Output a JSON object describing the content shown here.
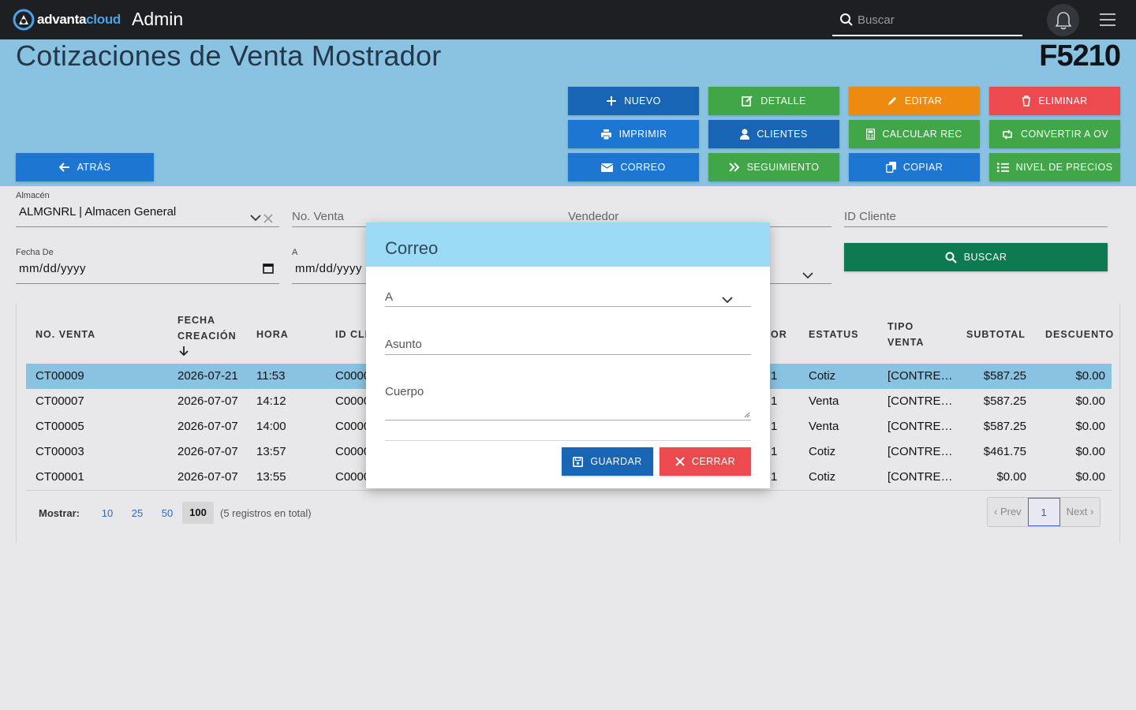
{
  "topbar": {
    "logo_part1": "advanta",
    "logo_part2": "cloud",
    "app_title": "Admin",
    "search_placeholder": "Buscar"
  },
  "header": {
    "title": "Cotizaciones de Venta Mostrador",
    "code": "F5210"
  },
  "actions": {
    "nuevo": "NUEVO",
    "detalle": "DETALLE",
    "editar": "EDITAR",
    "eliminar": "ELIMINAR",
    "imprimir": "IMPRIMIR",
    "clientes": "CLIENTES",
    "calcular_rec": "CALCULAR REC",
    "convertir_ov": "CONVERTIR A OV",
    "atras": "ATRÁS",
    "correo": "CORREO",
    "seguimiento": "SEGUIMIENTO",
    "copiar": "COPIAR",
    "nivel_precios": "NIVEL DE PRECIOS",
    "buscar": "BUSCAR"
  },
  "filters": {
    "almacen_label": "Almacén",
    "almacen_value": "ALMGNRL | Almacen General",
    "no_venta_placeholder": "No. Venta",
    "vendedor_placeholder": "Vendedor",
    "id_cliente_placeholder": "ID Cliente",
    "fecha_de_label": "Fecha De",
    "fecha_de_value": "mm/dd/yyyy",
    "fecha_a_label": "A",
    "fecha_a_value": "mm/dd/yyyy"
  },
  "table": {
    "headers": {
      "no_venta": "NO. VENTA",
      "fecha_l1": "FECHA",
      "fecha_l2": "CREACIÓN",
      "hora": "HORA",
      "id_cliente": "ID CLI",
      "vendedor_tail": "OR",
      "estatus": "ESTATUS",
      "tipo_l1": "TIPO",
      "tipo_l2": "VENTA",
      "subtotal": "SUBTOTAL",
      "descuento": "DESCUENTO"
    },
    "rows": [
      {
        "no": "CT00009",
        "fecha": "2026-07-21",
        "hora": "11:53",
        "cliente": "C0000",
        "vend": "1",
        "estatus": "Cotiz",
        "tipo": "[CONTRE…",
        "subtotal": "$587.25",
        "descuento": "$0.00"
      },
      {
        "no": "CT00007",
        "fecha": "2026-07-07",
        "hora": "14:12",
        "cliente": "C0000",
        "vend": "1",
        "estatus": "Venta",
        "tipo": "[CONTRE…",
        "subtotal": "$587.25",
        "descuento": "$0.00"
      },
      {
        "no": "CT00005",
        "fecha": "2026-07-07",
        "hora": "14:00",
        "cliente": "C0000",
        "vend": "1",
        "estatus": "Venta",
        "tipo": "[CONTRE…",
        "subtotal": "$587.25",
        "descuento": "$0.00"
      },
      {
        "no": "CT00003",
        "fecha": "2026-07-07",
        "hora": "13:57",
        "cliente": "C0000",
        "vend": "1",
        "estatus": "Cotiz",
        "tipo": "[CONTRE…",
        "subtotal": "$461.75",
        "descuento": "$0.00"
      },
      {
        "no": "CT00001",
        "fecha": "2026-07-07",
        "hora": "13:55",
        "cliente": "C0000",
        "vend": "1",
        "estatus": "Cotiz",
        "tipo": "[CONTRE…",
        "subtotal": "$0.00",
        "descuento": "$0.00"
      }
    ]
  },
  "pager": {
    "mostrar_label": "Mostrar:",
    "sizes": [
      "10",
      "25",
      "50",
      "100"
    ],
    "total": "(5 registros en total)",
    "prev": "‹ Prev",
    "current": "1",
    "next": "Next ›"
  },
  "modal": {
    "title": "Correo",
    "to_placeholder": "A",
    "subject_placeholder": "Asunto",
    "body_placeholder": "Cuerpo",
    "save": "GUARDAR",
    "close": "CERRAR"
  }
}
